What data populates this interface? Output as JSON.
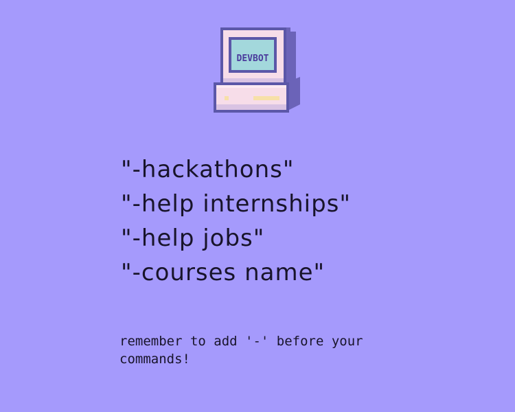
{
  "logo": {
    "screen_text": "DEVBOT",
    "icon": "retro-computer-icon",
    "colors": {
      "body": "#f7dde9",
      "body_shadow": "#c9b3d9",
      "outline": "#5b57a8",
      "screen": "#a3d8dc",
      "screen_text": "#4a3b9c",
      "accent": "#f7e0a8"
    }
  },
  "commands": [
    {
      "text": "\"-hackathons\""
    },
    {
      "text": "\"-help internships\""
    },
    {
      "text": "\"-help jobs\""
    },
    {
      "text": "\"-courses name\""
    }
  ],
  "reminder": "remember to add '-' before your commands!",
  "colors": {
    "background": "#a59afc",
    "text": "#18142a"
  }
}
